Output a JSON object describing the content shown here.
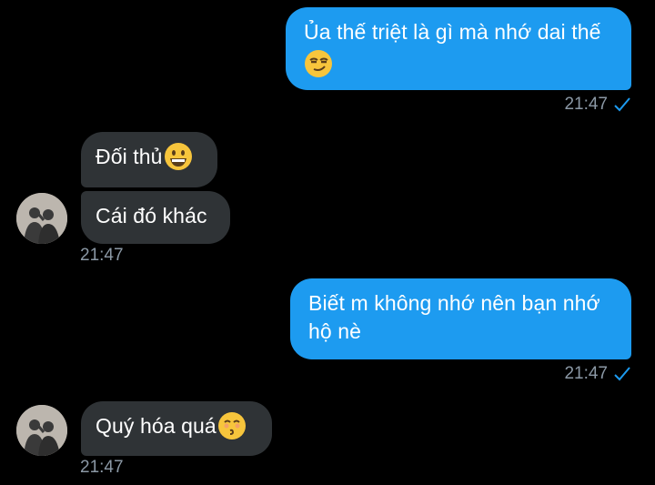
{
  "messages": {
    "m1": {
      "text": "Ủa thế triệt là gì mà nhớ dai thế",
      "emoji": "smirk-emoji",
      "time": "21:47"
    },
    "m2": {
      "text": "Đối thủ",
      "emoji": "grin-emoji"
    },
    "m3": {
      "text": "Cái đó khác",
      "time": "21:47"
    },
    "m4": {
      "line1": "Biết m không nhớ nên bạn nhớ",
      "line2": "hộ nè",
      "time": "21:47"
    },
    "m5": {
      "text": "Quý hóa quá",
      "emoji": "kissing-emoji",
      "time": "21:47"
    }
  },
  "colors": {
    "outgoing_bubble": "#1d9bf0",
    "incoming_bubble": "#2f3336",
    "timestamp": "#8b98a5",
    "read_check": "#1d9bf0"
  },
  "icons": {
    "read_receipt": "check-icon",
    "avatar": "user-avatar"
  }
}
